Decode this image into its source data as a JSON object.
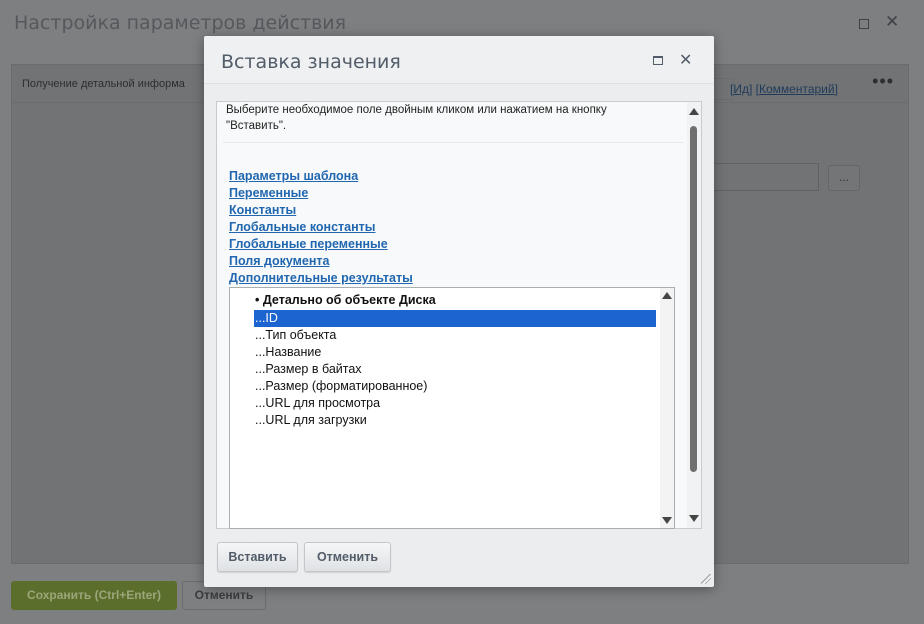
{
  "background_window": {
    "title": "Настройка параметров действия",
    "panel_title": "Получение детальной информа",
    "panel_menu": "•••",
    "links_prefix": "[",
    "link_id": "Ид",
    "links_sep": "] [",
    "link_comment": "Комментарий",
    "links_suffix": "]",
    "ellipsis_button": "...",
    "save_button": "Сохранить (Ctrl+Enter)",
    "cancel_button": "Отменить",
    "maximize_icon": "maximize-icon",
    "close_icon": "close-icon"
  },
  "dialog": {
    "title": "Вставка значения",
    "close_glyph": "✕",
    "instruction": "Выберите необходимое поле двойным кликом или нажатием на кнопку \"Вставить\".",
    "links": [
      "Параметры шаблона",
      "Переменные",
      "Константы",
      "Глобальные константы",
      "Глобальные переменные",
      "Поля документа",
      "Дополнительные результаты"
    ],
    "listbox": {
      "group": "• Детально об объекте Диска",
      "options": [
        "...ID",
        "...Тип объекта",
        "...Название",
        "...Размер в байтах",
        "...Размер (форматированное)",
        "...URL для просмотра",
        "...URL для загрузки"
      ],
      "selected_index": 0
    },
    "insert_button": "Вставить",
    "cancel_button": "Отменить"
  },
  "colors": {
    "overlay": "#7d7f81",
    "link": "#2067b0",
    "selection": "#1c64d0",
    "save_button": "#5b6e2c"
  }
}
